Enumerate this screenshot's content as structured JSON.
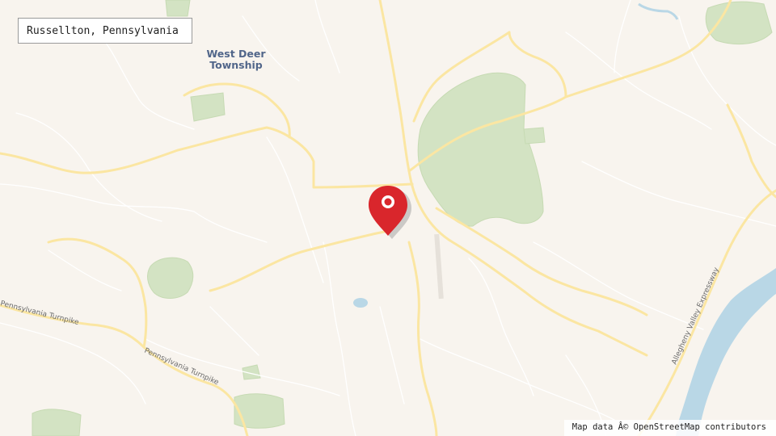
{
  "location": {
    "name": "Russellton, Pennsylvania",
    "marker_icon": "map-pin-icon",
    "marker_color": "#d9262c"
  },
  "labels": {
    "place": "West Deer\nTownship",
    "road_turnpike": "Pennsylvania Turnpike",
    "road_expressway": "Allegheny Valley Expressway"
  },
  "attribution": {
    "text": "Map data Â© OpenStreetMap contributors"
  },
  "colors": {
    "background": "#f8f4ee",
    "major_road": "#fbe6a2",
    "minor_road": "#ffffff",
    "park": "#d3e3c3",
    "water": "#b9d7e6",
    "place_label": "#51668a"
  }
}
